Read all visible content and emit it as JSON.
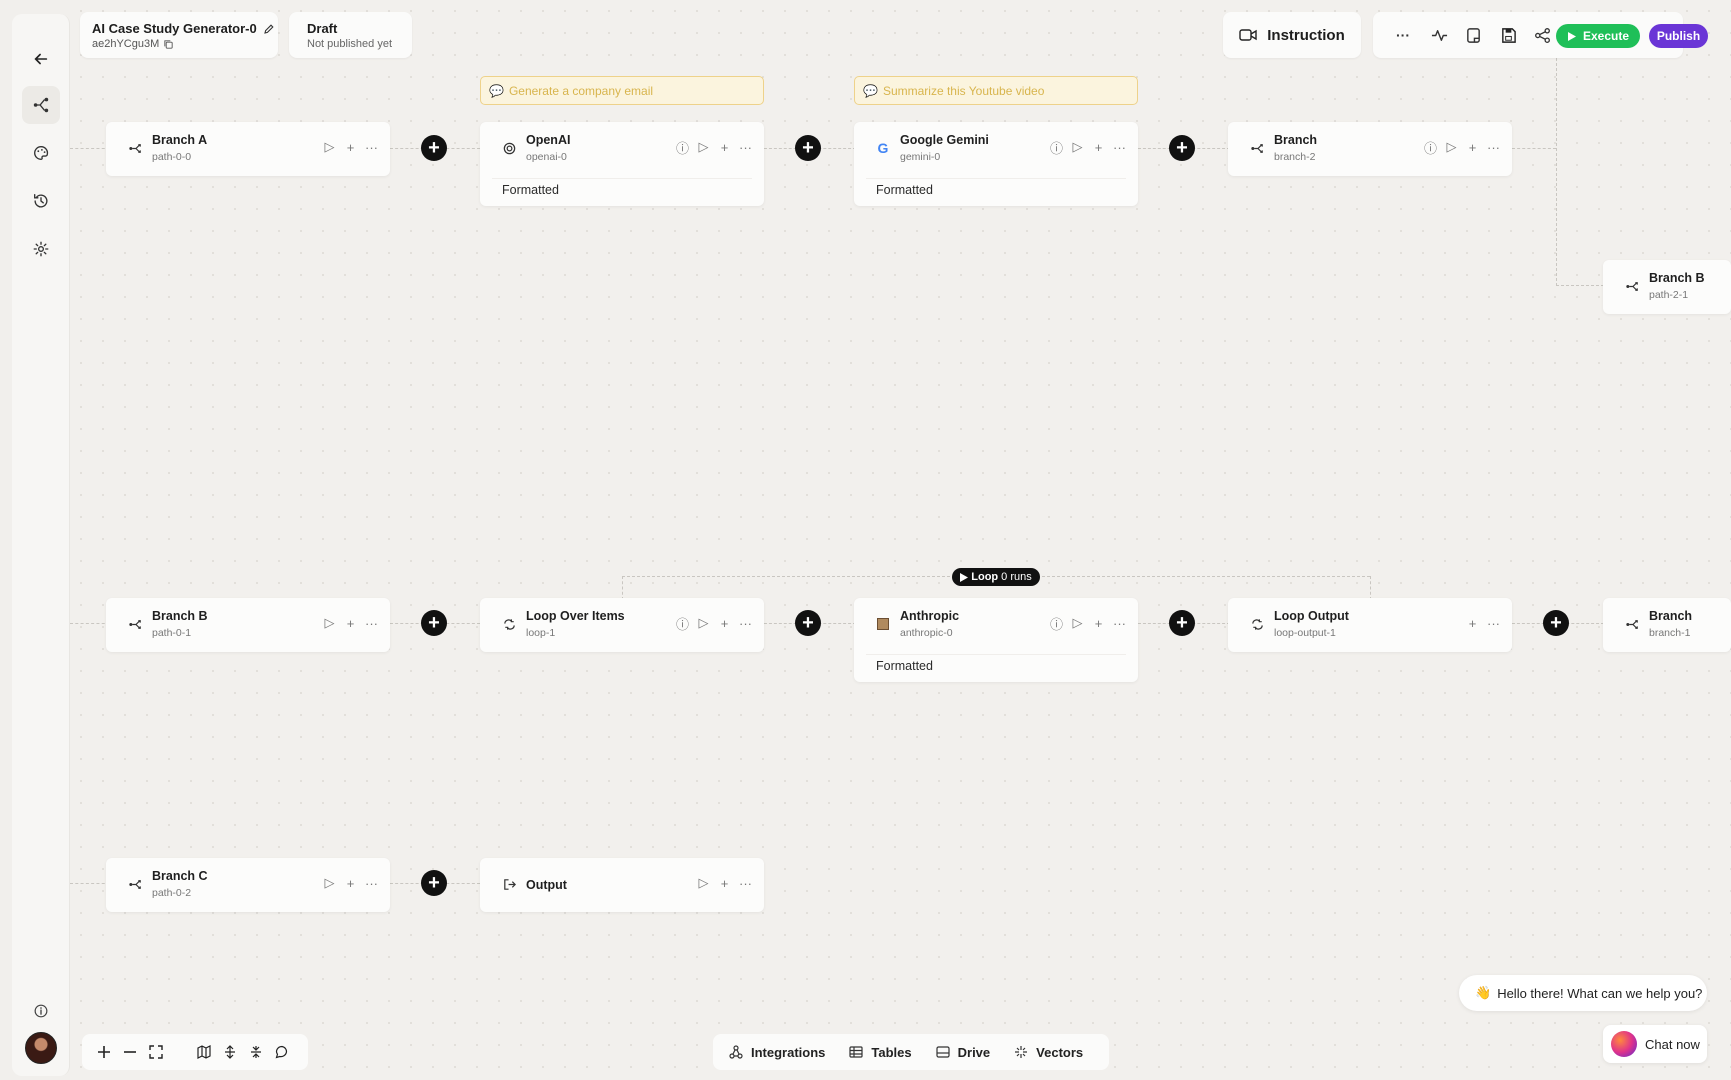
{
  "header": {
    "title": "AI Case Study Generator-0",
    "workflow_id": "ae2hYCgu3M",
    "status": "Draft",
    "status_sub": "Not published yet",
    "instruction_label": "Instruction",
    "execute_label": "Execute",
    "publish_label": "Publish"
  },
  "colors": {
    "execute": "#1fbf58",
    "publish": "#6a35d6",
    "note_bg": "#fbf4de"
  },
  "notes": [
    "Generate a company email",
    "Summarize this Youtube video"
  ],
  "nodes": {
    "branch_a": {
      "name": "Branch A",
      "sub": "path-0-0"
    },
    "openai": {
      "name": "OpenAI",
      "sub": "openai-0",
      "output": "Formatted"
    },
    "gemini": {
      "name": "Google Gemini",
      "sub": "gemini-0",
      "output": "Formatted"
    },
    "branch2": {
      "name": "Branch",
      "sub": "branch-2"
    },
    "branch_b_right": {
      "name": "Branch B",
      "sub": "path-2-1"
    },
    "branch_b": {
      "name": "Branch B",
      "sub": "path-0-1"
    },
    "loop": {
      "name": "Loop Over Items",
      "sub": "loop-1"
    },
    "anthropic": {
      "name": "Anthropic",
      "sub": "anthropic-0",
      "output": "Formatted"
    },
    "loop_output": {
      "name": "Loop Output",
      "sub": "loop-output-1"
    },
    "branch1": {
      "name": "Branch",
      "sub": "branch-1"
    },
    "branch_c": {
      "name": "Branch C",
      "sub": "path-0-2"
    },
    "output": {
      "name": "Output"
    }
  },
  "loop_badge": {
    "label": "Loop",
    "runs": "0 runs"
  },
  "resources": [
    "Integrations",
    "Tables",
    "Drive",
    "Vectors"
  ],
  "chat": {
    "greeting": "Hello there! What can we help you?",
    "button": "Chat now"
  },
  "glyphs": {
    "more": "···",
    "plus": "+",
    "play": "▷",
    "info": "ⓘ"
  }
}
